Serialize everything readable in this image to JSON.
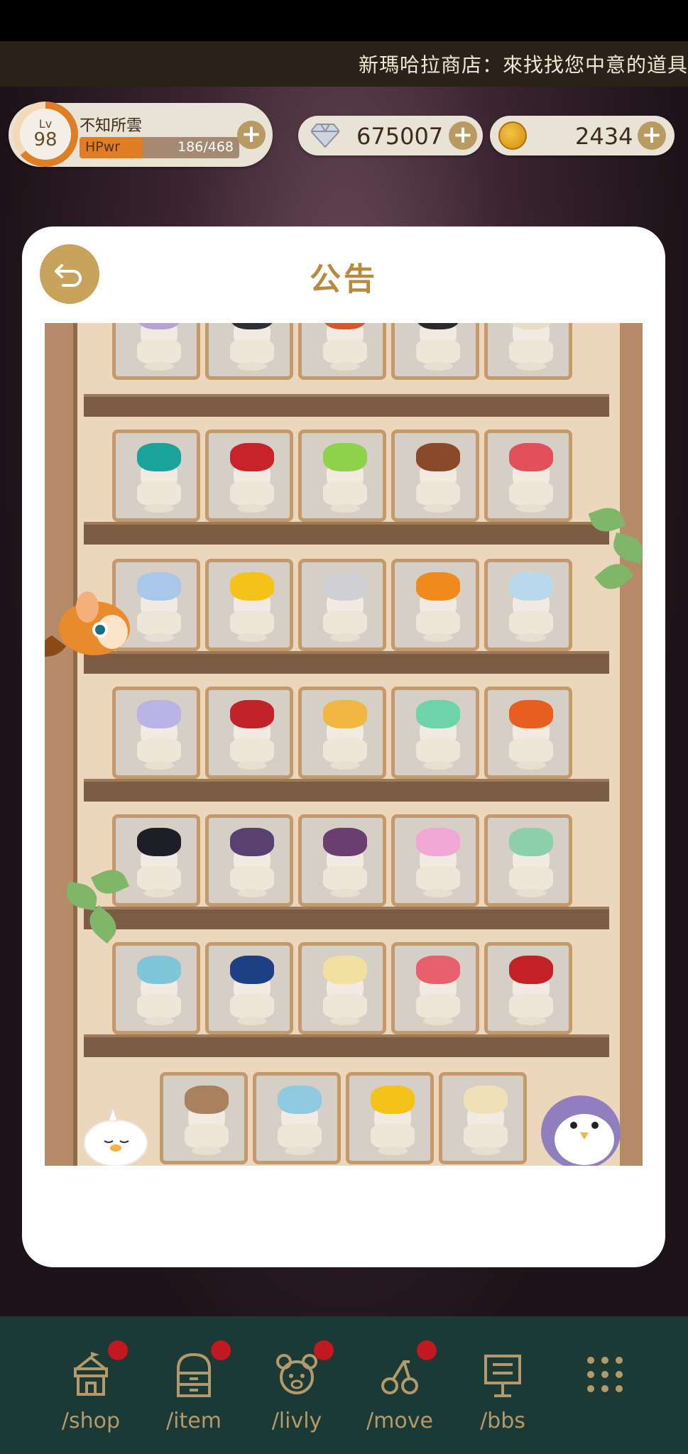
{
  "marquee": {
    "text": "新瑪哈拉商店：來找找您中意的道具"
  },
  "player": {
    "level_label": "Lv",
    "level": "98",
    "name": "不知所雲",
    "hp_label": "HPwr",
    "hp_value": "186/468",
    "hp_fraction": 0.397
  },
  "currencies": {
    "gems": "675007",
    "coins": "2434"
  },
  "modal": {
    "title": "公告"
  },
  "colors": {
    "accent": "#c8a35c",
    "nav_bg": "#1c3a35",
    "badge": "#c2181f",
    "hp_fill": "#e07e25"
  },
  "shelf": {
    "rows": [
      {
        "pets": [
          "#b7a2d6",
          "#2f2f3a",
          "#d9562a",
          "#2b2b2b",
          "#e6dcc8"
        ]
      },
      {
        "pets": [
          "#1aa39a",
          "#c8232b",
          "#8ed14a",
          "#8a4a2a",
          "#e0505a"
        ]
      },
      {
        "pets": [
          "#a9c7e8",
          "#f5c21a",
          "#cfcfd4",
          "#f08a1f",
          "#b9d9ec"
        ]
      },
      {
        "pets": [
          "#b9b3e6",
          "#c2232a",
          "#f0b640",
          "#6cd4a8",
          "#e85e1e"
        ]
      },
      {
        "pets": [
          "#1e1e26",
          "#5a4070",
          "#6a3e6e",
          "#f2a6d6",
          "#8ccfaa"
        ]
      },
      {
        "pets": [
          "#7fc6d8",
          "#1d3f86",
          "#f2e0a0",
          "#e8606e",
          "#c22226"
        ]
      },
      {
        "pets": [
          "#a8815f",
          "#8fcbe0",
          "#f5c21a",
          "#f0e0b8"
        ]
      }
    ]
  },
  "nav": {
    "items": [
      {
        "label": "/shop",
        "icon": "shop-tent-icon"
      },
      {
        "label": "/item",
        "icon": "drawer-icon"
      },
      {
        "label": "/livly",
        "icon": "livly-face-icon"
      },
      {
        "label": "/move",
        "icon": "move-icon"
      },
      {
        "label": "/bbs",
        "icon": "signboard-icon"
      },
      {
        "label": "",
        "icon": "more-grid-icon"
      }
    ]
  }
}
